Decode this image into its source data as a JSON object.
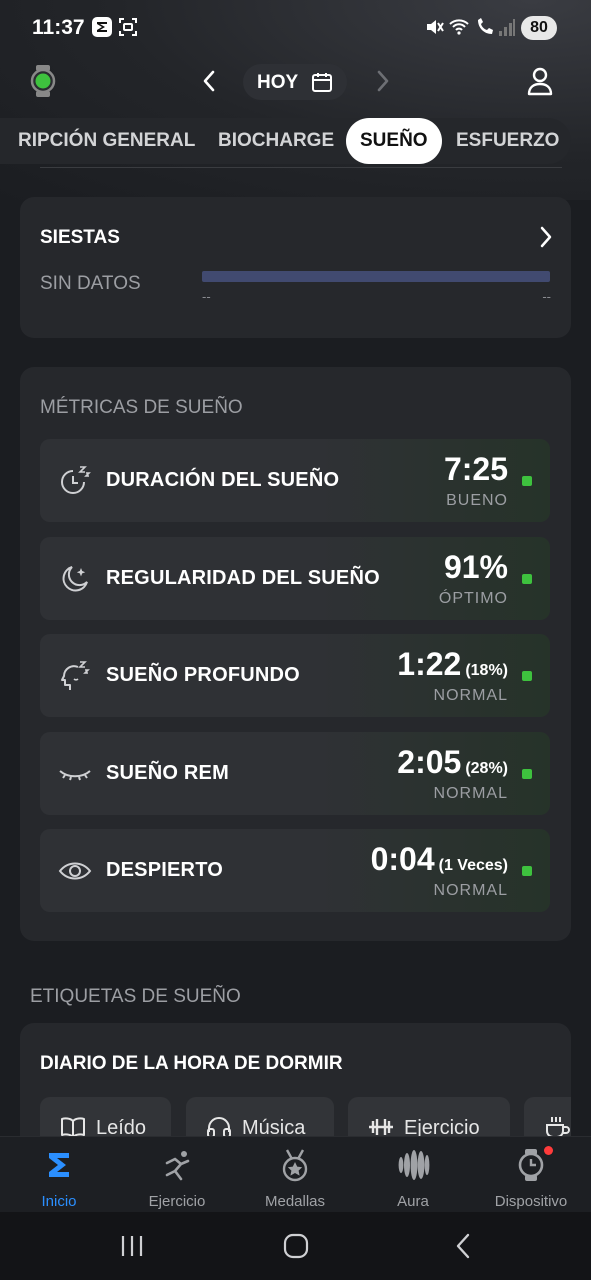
{
  "status_bar": {
    "time": "11:37",
    "battery": "80"
  },
  "header": {
    "date_label": "HOY"
  },
  "tabs": [
    {
      "label": "RIPCIÓN GENERAL"
    },
    {
      "label": "BIOCHARGE"
    },
    {
      "label": "SUEÑO",
      "active": true
    },
    {
      "label": "ESFUERZO"
    }
  ],
  "siestas": {
    "title": "SIESTAS",
    "no_data": "SIN DATOS",
    "range_start": "--",
    "range_end": "--"
  },
  "sleep_metrics": {
    "title": "MÉTRICAS DE SUEÑO",
    "rows": [
      {
        "icon": "sleep-clock-icon",
        "label": "DURACIÓN DEL SUEÑO",
        "value": "7:25",
        "extra": "",
        "status": "BUENO"
      },
      {
        "icon": "moon-sparkle-icon",
        "label": "REGULARIDAD DEL SUEÑO",
        "value": "91%",
        "extra": "",
        "status": "ÓPTIMO"
      },
      {
        "icon": "head-sleep-icon",
        "label": "SUEÑO PROFUNDO",
        "value": "1:22",
        "extra": "(18%)",
        "status": "NORMAL"
      },
      {
        "icon": "closed-eye-icon",
        "label": "SUEÑO REM",
        "value": "2:05",
        "extra": "(28%)",
        "status": "NORMAL"
      },
      {
        "icon": "eye-icon",
        "label": "DESPIERTO",
        "value": "0:04",
        "extra": "(1 Veces)",
        "status": "NORMAL"
      }
    ],
    "status_color": "#3ec23e"
  },
  "sleep_tags": {
    "title": "ETIQUETAS DE SUEÑO",
    "diary_title": "DIARIO DE LA HORA DE DORMIR",
    "chips": [
      {
        "icon": "book-icon",
        "label": "Leído"
      },
      {
        "icon": "headphones-icon",
        "label": "Música"
      },
      {
        "icon": "dumbbell-icon",
        "label": "Ejercicio"
      },
      {
        "icon": "cup-icon",
        "label": ""
      }
    ]
  },
  "bottom_nav": [
    {
      "icon": "home-logo-icon",
      "label": "Inicio",
      "active": true
    },
    {
      "icon": "exercise-icon",
      "label": "Ejercicio"
    },
    {
      "icon": "medal-icon",
      "label": "Medallas"
    },
    {
      "icon": "aura-icon",
      "label": "Aura"
    },
    {
      "icon": "watch-device-icon",
      "label": "Dispositivo"
    }
  ],
  "accent_color": "#2b8fff"
}
